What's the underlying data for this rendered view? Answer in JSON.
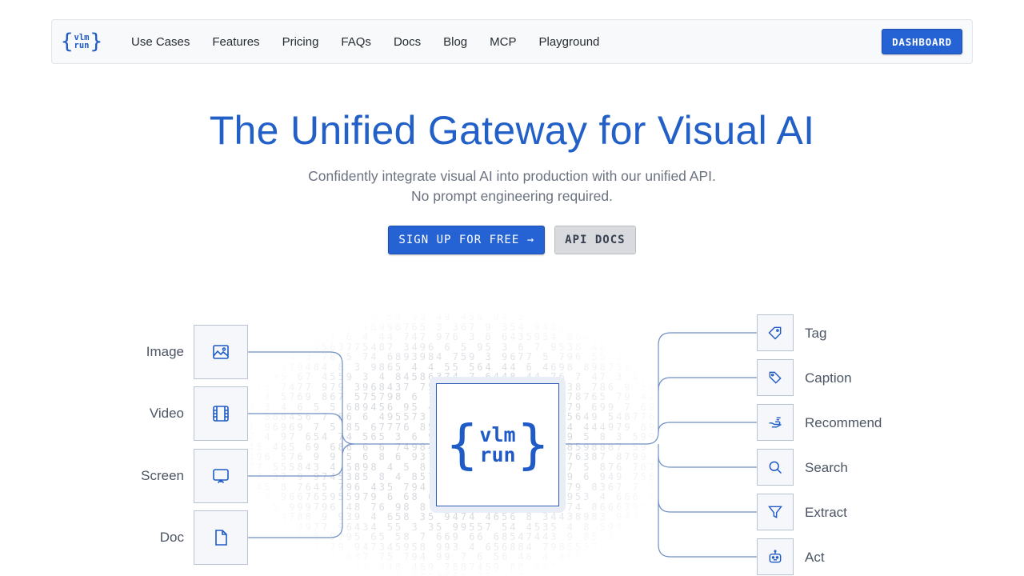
{
  "nav": {
    "logo_top": "vlm",
    "logo_bottom": "run",
    "links": [
      "Use Cases",
      "Features",
      "Pricing",
      "FAQs",
      "Docs",
      "Blog",
      "MCP",
      "Playground"
    ],
    "dashboard_label": "DASHBOARD"
  },
  "hero": {
    "title": "The Unified Gateway for Visual AI",
    "subtitle_line1": "Confidently integrate visual AI into production with our unified API.",
    "subtitle_line2": "No prompt engineering required.",
    "signup_label": "SIGN UP FOR FREE →",
    "api_docs_label": "API DOCS"
  },
  "diagram": {
    "center_top": "vlm",
    "center_bottom": "run",
    "inputs": [
      {
        "label": "Image",
        "icon": "image-icon"
      },
      {
        "label": "Video",
        "icon": "film-icon"
      },
      {
        "label": "Screen",
        "icon": "monitor-icon"
      },
      {
        "label": "Doc",
        "icon": "document-icon"
      }
    ],
    "outputs": [
      {
        "label": "Tag",
        "icon": "tag-icon"
      },
      {
        "label": "Caption",
        "icon": "pen-tag-icon"
      },
      {
        "label": "Recommend",
        "icon": "hand-icon"
      },
      {
        "label": "Search",
        "icon": "search-icon"
      },
      {
        "label": "Extract",
        "icon": "filter-icon"
      },
      {
        "label": "Act",
        "icon": "robot-icon"
      }
    ],
    "colors": {
      "accent": "#2260c8",
      "wire": "#6f8fc4"
    }
  }
}
